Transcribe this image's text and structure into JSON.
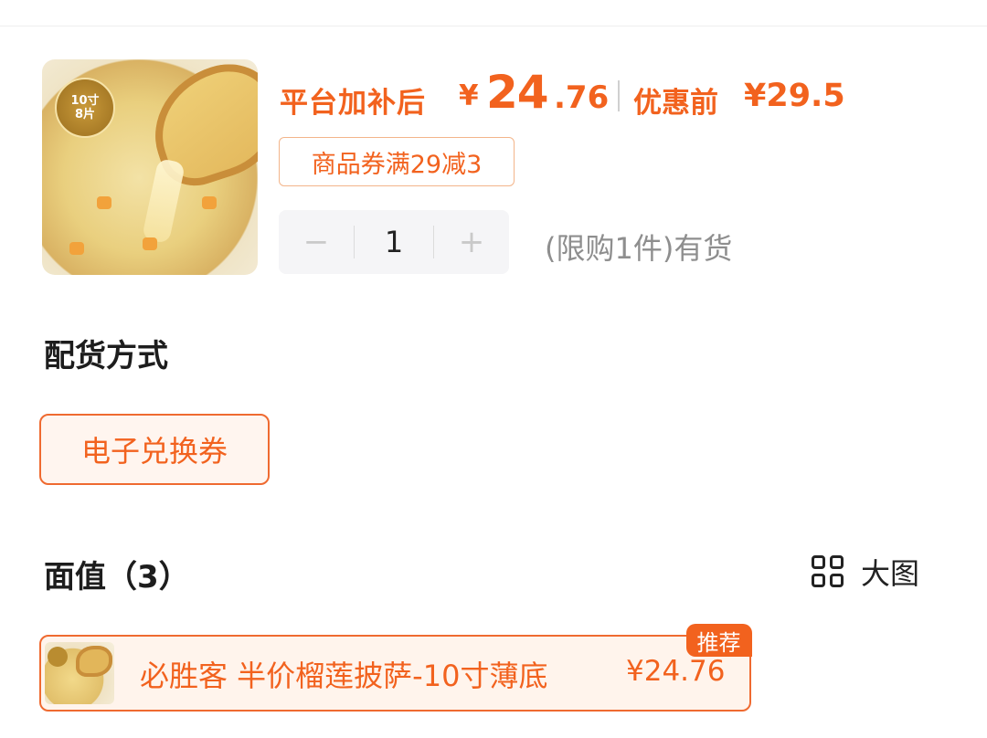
{
  "product": {
    "badge_line1": "10寸",
    "badge_line2": "8片",
    "price_label": "平台加补后",
    "currency": "¥",
    "price_int": "24",
    "price_dec": ".76",
    "orig_label": "优惠前",
    "orig_price": "¥29.5",
    "coupon_tag": "商品券满29减3",
    "quantity": {
      "minus": "−",
      "value": "1",
      "plus": "+"
    },
    "stock_note": "(限购1件)有货"
  },
  "delivery": {
    "title": "配货方式",
    "option": "电子兑换券"
  },
  "face_value": {
    "title": "面值（3）",
    "big_view_label": "大图",
    "items": [
      {
        "name": "必胜客 半价榴莲披萨-10寸薄底",
        "price": "¥24.76",
        "badge": "推荐"
      }
    ]
  },
  "colors": {
    "accent": "#f2621e",
    "border_accent": "#ef6a30",
    "muted": "#8e8e8e"
  },
  "icons": [
    "grid-view-icon",
    "minus-icon",
    "plus-icon"
  ]
}
